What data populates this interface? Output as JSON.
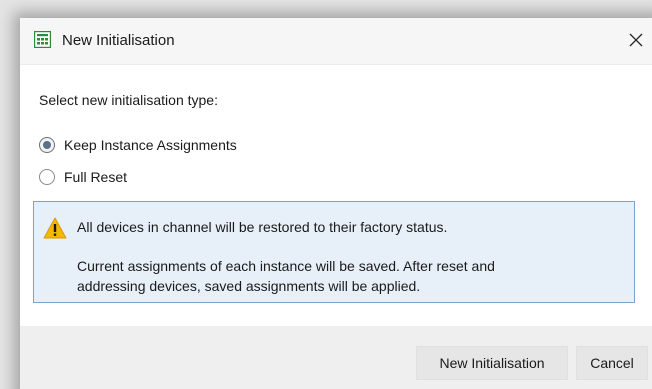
{
  "dialog": {
    "title": "New Initialisation",
    "app_icon": "grid-window-icon",
    "close_icon": "close-x-icon"
  },
  "content": {
    "prompt": "Select new initialisation type:",
    "options": [
      {
        "label": "Keep Instance Assignments",
        "selected": true
      },
      {
        "label": "Full Reset",
        "selected": false
      }
    ]
  },
  "warning": {
    "icon": "warning-triangle-icon",
    "headline": "All devices in channel will be restored to their factory status.",
    "detail_line1": "Current assignments of each instance will be saved. After reset and",
    "detail_line2": "addressing devices, saved assignments will be applied."
  },
  "buttons": {
    "confirm": "New Initialisation",
    "cancel": "Cancel"
  },
  "colors": {
    "app_icon": "#2e8b3a",
    "warning_fill": "#f5b800",
    "info_background": "#e7f0f8",
    "info_border": "#7fa3c8"
  }
}
